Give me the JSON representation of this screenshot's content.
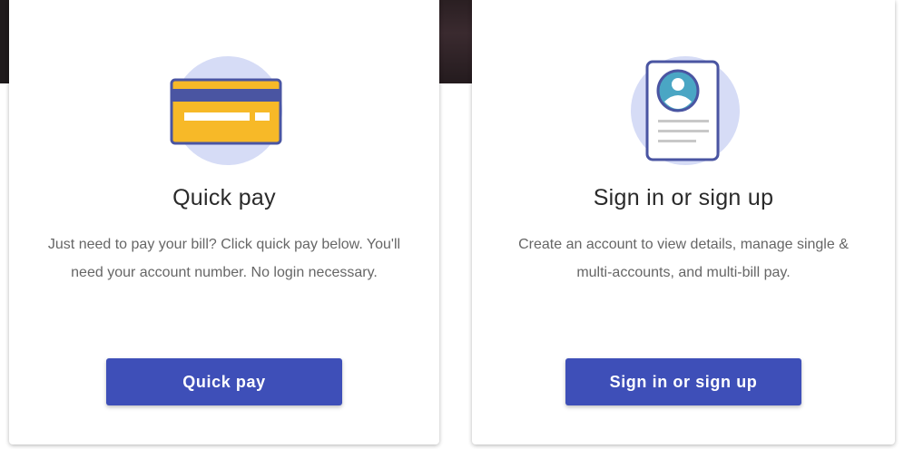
{
  "cards": [
    {
      "icon": "credit-card-icon",
      "title": "Quick pay",
      "description": "Just need to pay your bill? Click quick pay below. You'll need your account number. No login necessary.",
      "button_label": "Quick pay"
    },
    {
      "icon": "account-profile-icon",
      "title": "Sign in or sign up",
      "description": "Create an account to view details, manage single & multi-accounts, and multi-bill pay.",
      "button_label": "Sign in or sign up"
    }
  ],
  "colors": {
    "button": "#3e4fb8",
    "icon_circle": "#d6dcf6",
    "card_yellow": "#f7b928",
    "card_stroke": "#4a55a2",
    "avatar_teal": "#4aa6c4"
  }
}
